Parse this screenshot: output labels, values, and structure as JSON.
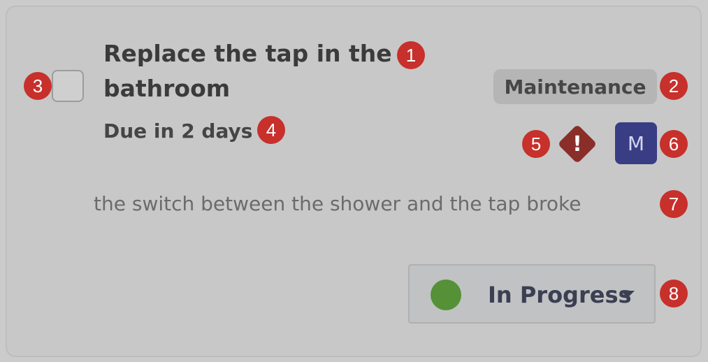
{
  "task": {
    "title": "Replace the tap in the bathroom",
    "due_text": "Due in 2 days",
    "tag_label": "Maintenance",
    "priority_icon": "exclamation-diamond-icon",
    "assignee_initial": "M",
    "description": "the switch between the shower and the tap broke",
    "status": {
      "label": "In Progress",
      "dot_color": "#559137"
    }
  },
  "colors": {
    "priority": "#8a2e2a",
    "avatar": "#393d84",
    "annotation_badge": "#c7302b"
  },
  "annotations": [
    "1",
    "2",
    "3",
    "4",
    "5",
    "6",
    "7",
    "8"
  ]
}
